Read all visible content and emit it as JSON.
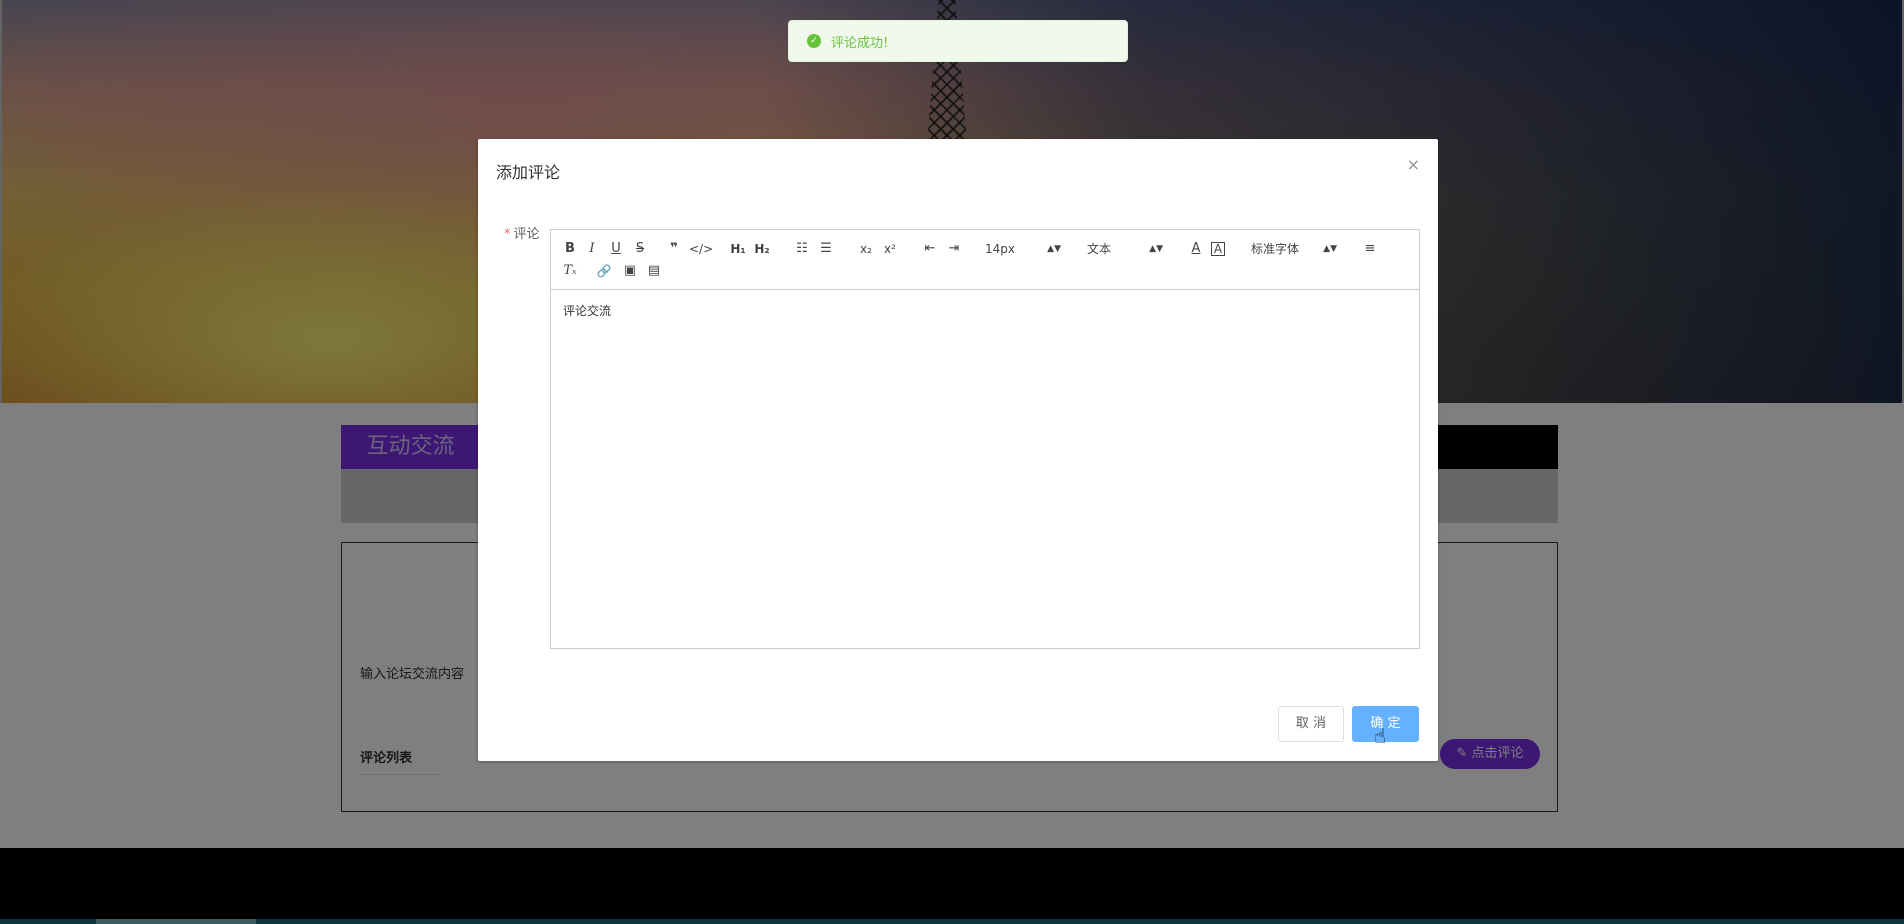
{
  "toast": {
    "message": "评论成功!",
    "icon": "success-check-icon",
    "color": "#67c23a"
  },
  "page": {
    "section_title": "互动交流",
    "content_hint": "输入论坛交流内容",
    "list_title": "评论列表",
    "comment_button": "点击评论"
  },
  "dialog": {
    "title": "添加评论",
    "close": "×",
    "field_label": "评论",
    "required_mark": "*",
    "toolbar": {
      "bold": "B",
      "italic": "I",
      "underline": "U",
      "strike": "S",
      "blockquote": "❞",
      "code": "</>",
      "h1": "H₁",
      "h2": "H₂",
      "ordered_list": "☷",
      "bullet_list": "☰",
      "subscript": "x₂",
      "superscript": "x²",
      "outdent": "⇤",
      "indent": "⇥",
      "size": "14px",
      "header": "文本",
      "text_color": "A",
      "background": "A",
      "font": "标准字体",
      "align": "≡",
      "clean": "Tₓ",
      "link": "🔗",
      "image": "▣",
      "video": "▤"
    },
    "content": "评论交流",
    "cancel": "取 消",
    "confirm": "确 定"
  },
  "colors": {
    "accent_purple": "#7a2ee8",
    "primary_blue": "#66b1ff"
  }
}
